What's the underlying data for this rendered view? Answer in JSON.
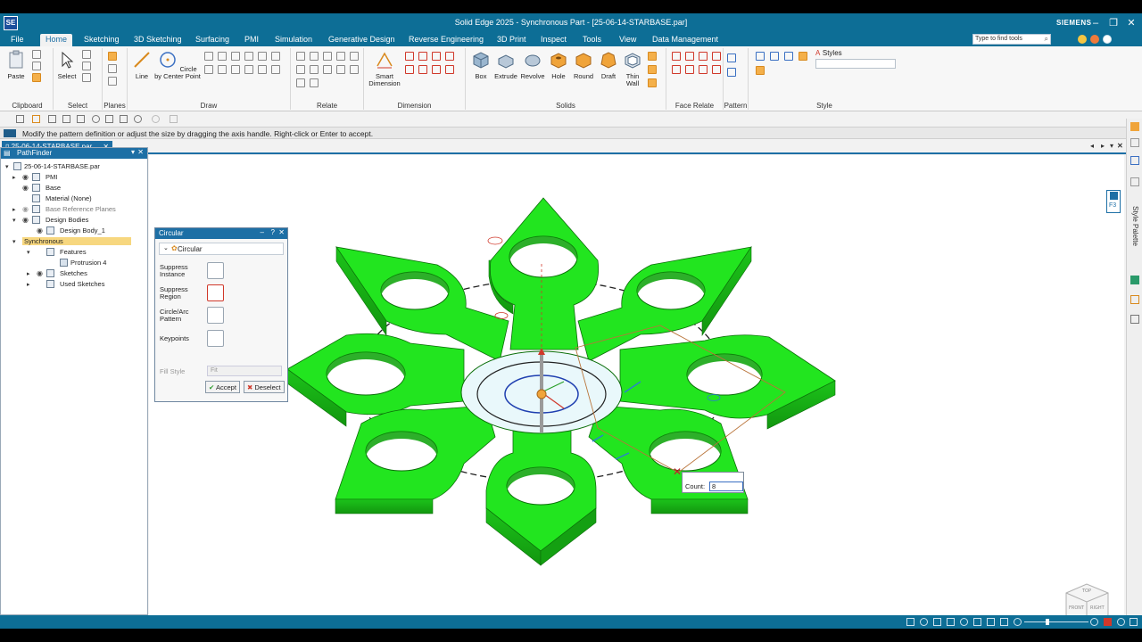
{
  "window": {
    "logo": "SE",
    "title": "Solid Edge 2025 - Synchronous Part - [25-06-14-STARBASE.par]",
    "brand": "SIEMENS",
    "minimize": "–",
    "restore": "❐",
    "close": "✕"
  },
  "menu": {
    "items": [
      "File",
      "Home",
      "Sketching",
      "3D Sketching",
      "Surfacing",
      "PMI",
      "Simulation",
      "Generative Design",
      "Reverse Engineering",
      "3D Print",
      "Inspect",
      "Tools",
      "View",
      "Data Management"
    ],
    "active": "Home",
    "search_placeholder": "Type to find tools"
  },
  "ribbon": {
    "paste": "Paste",
    "select": "Select",
    "line": "Line",
    "circle": "Circle by Center Point",
    "smart_dimension": "Smart Dimension",
    "box": "Box",
    "extrude": "Extrude",
    "revolve": "Revolve",
    "hole": "Hole",
    "round": "Round",
    "draft": "Draft",
    "thin_wall": "Thin Wall",
    "styles": "Styles",
    "groups": {
      "clipboard": "Clipboard",
      "select": "Select",
      "planes": "Planes",
      "draw": "Draw",
      "relate": "Relate",
      "dimension": "Dimension",
      "solids": "Solids",
      "face_relate": "Face Relate",
      "pattern": "Pattern",
      "style": "Style"
    }
  },
  "prompt": "Modify the pattern definition or adjust the size by dragging the axis handle.  Right-click or Enter to accept.",
  "doc_tab": {
    "label": "25-06-14-STARBASE.par",
    "close": "✕"
  },
  "pathfinder": {
    "title": "PathFinder",
    "root": "25-06-14-STARBASE.par",
    "items": {
      "pmi": "PMI",
      "base": "Base",
      "material": "Material (None)",
      "ref_planes": "Base Reference Planes",
      "design_bodies": "Design Bodies",
      "design_body_1": "Design Body_1",
      "synchronous": "Synchronous",
      "features": "Features",
      "protrusion": "Protrusion 4",
      "sketches": "Sketches",
      "used_sketches": "Used Sketches"
    }
  },
  "circular_dialog": {
    "title": "Circular",
    "type": "Circular",
    "suppress_instance": "Suppress Instance",
    "suppress_region": "Suppress Region",
    "circle_arc_pattern": "Circle/Arc Pattern",
    "keypoints": "Keypoints",
    "fill_style_label": "Fill Style",
    "fill_style_value": "Fit",
    "accept": "Accept",
    "deselect": "Deselect"
  },
  "count_box": {
    "label": "Count:",
    "value": "8"
  },
  "right_dock": {
    "key": "F3",
    "style_palette": "Style Palette"
  },
  "view_cube": {
    "top": "TOP",
    "front": "FRONT",
    "right": "RIGHT"
  },
  "colors": {
    "title_bar": "#0d6e96",
    "accent": "#1d6fa5",
    "part_green": "#22e51f",
    "part_green_dark": "#14a012",
    "sync_highlight": "#f7d77f"
  }
}
